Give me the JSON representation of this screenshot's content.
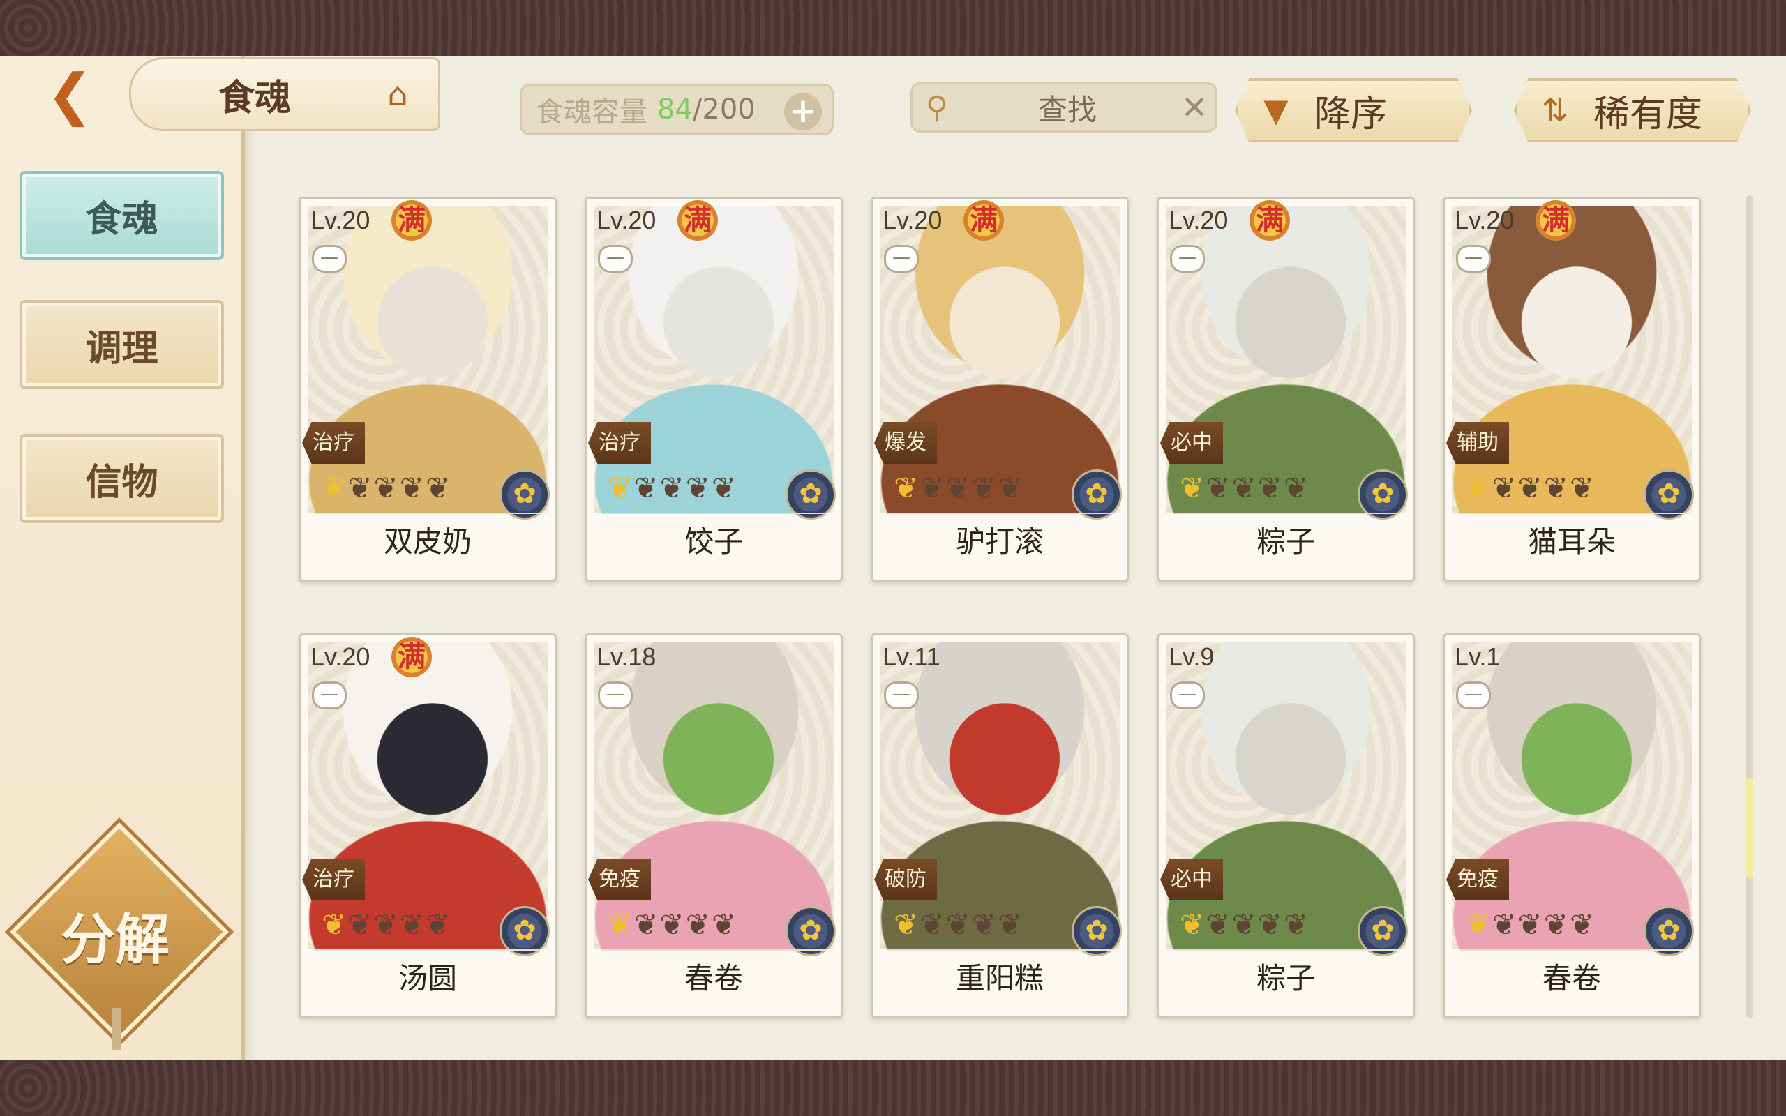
{
  "header": {
    "title": "食魂",
    "capacity_label": "食魂容量",
    "capacity_current": "84",
    "capacity_separator": "/",
    "capacity_max": "200",
    "add_label": "+",
    "search_label": "查找",
    "clear_label": "✕",
    "sort_order_label": "降序",
    "sort_field_label": "稀有度"
  },
  "sidebar": {
    "tabs": [
      {
        "label": "食魂",
        "active": true
      },
      {
        "label": "调理",
        "active": false
      },
      {
        "label": "信物",
        "active": false
      }
    ],
    "decompose_label": "分解"
  },
  "cards": [
    {
      "level": "Lv.20",
      "full": "满",
      "role": "治疗",
      "name": "双皮奶",
      "stars_lit": 1,
      "stars_total": 5,
      "palette": [
        "#f6e9c7",
        "#d9b46a",
        "#e8e2d6"
      ]
    },
    {
      "level": "Lv.20",
      "full": "满",
      "role": "治疗",
      "name": "饺子",
      "stars_lit": 1,
      "stars_total": 5,
      "palette": [
        "#f2f1ef",
        "#9bd3d8",
        "#e6e4df"
      ]
    },
    {
      "level": "Lv.20",
      "full": "满",
      "role": "爆发",
      "name": "驴打滚",
      "stars_lit": 1,
      "stars_total": 5,
      "palette": [
        "#e6c27a",
        "#8b4a2a",
        "#f3e7d3"
      ]
    },
    {
      "level": "Lv.20",
      "full": "满",
      "role": "必中",
      "name": "粽子",
      "stars_lit": 1,
      "stars_total": 5,
      "palette": [
        "#e7e9e4",
        "#6d8a4a",
        "#d8d6cc"
      ]
    },
    {
      "level": "Lv.20",
      "full": "满",
      "role": "辅助",
      "name": "猫耳朵",
      "stars_lit": 1,
      "stars_total": 5,
      "palette": [
        "#8a5a3c",
        "#e7b95a",
        "#f2eee6"
      ]
    },
    {
      "level": "Lv.20",
      "full": "满",
      "role": "治疗",
      "name": "汤圆",
      "stars_lit": 1,
      "stars_total": 5,
      "palette": [
        "#f6f3ee",
        "#c43a2c",
        "#2c2a33"
      ]
    },
    {
      "level": "Lv.18",
      "full": "",
      "role": "免疫",
      "name": "春卷",
      "stars_lit": 1,
      "stars_total": 5,
      "palette": [
        "#d9d2c4",
        "#e9a3b4",
        "#7fb35a"
      ]
    },
    {
      "level": "Lv.11",
      "full": "",
      "role": "破防",
      "name": "重阳糕",
      "stars_lit": 1,
      "stars_total": 5,
      "palette": [
        "#d7d3cb",
        "#6e6a44",
        "#c23a2c"
      ]
    },
    {
      "level": "Lv.9",
      "full": "",
      "role": "必中",
      "name": "粽子",
      "stars_lit": 1,
      "stars_total": 5,
      "palette": [
        "#e7e9e4",
        "#6d8a4a",
        "#d8d6cc"
      ]
    },
    {
      "level": "Lv.1",
      "full": "",
      "role": "免疫",
      "name": "春卷",
      "stars_lit": 1,
      "stars_total": 5,
      "palette": [
        "#d9d2c4",
        "#e9a3b4",
        "#7fb35a"
      ]
    }
  ],
  "icons": {
    "back": "back-arrow-icon",
    "home": "pavilion-icon",
    "search": "magnifier-icon",
    "sort_order": "triangle-down-icon",
    "sort_field": "sort-arrows-icon",
    "lock": "lock-icon",
    "element": "flower-emblem-icon"
  },
  "colors": {
    "capacity_current": "#7ecb5b",
    "active_tab": "#a8dbd3",
    "accent": "#b9681f"
  }
}
